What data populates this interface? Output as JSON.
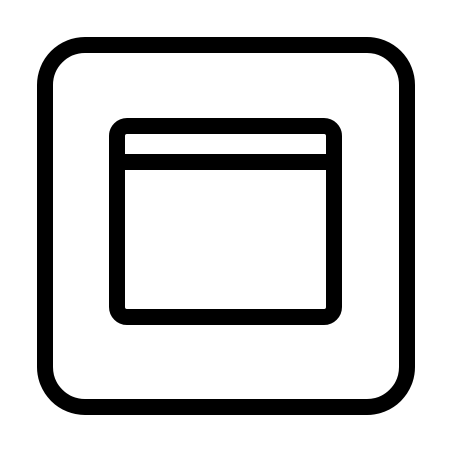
{
  "icon": {
    "name": "window-in-frame-icon",
    "stroke_color": "#000000",
    "fill_color": "#ffffff",
    "background_color": "#ffffff"
  }
}
